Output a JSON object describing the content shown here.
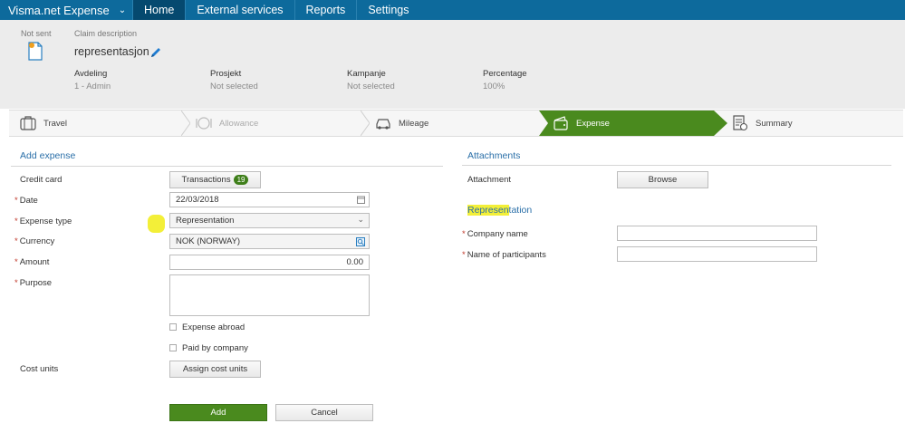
{
  "nav": {
    "brand": "Visma.net Expense",
    "tabs": [
      "Home",
      "External services",
      "Reports",
      "Settings"
    ],
    "active_tab": "Home"
  },
  "header": {
    "status": "Not sent",
    "claim_label": "Claim description",
    "claim_title": "representasjon",
    "meta": [
      {
        "key": "Avdeling",
        "value": "1 - Admin"
      },
      {
        "key": "Prosjekt",
        "value": "Not selected"
      },
      {
        "key": "Kampanje",
        "value": "Not selected"
      },
      {
        "key": "Percentage",
        "value": "100%"
      }
    ]
  },
  "steps": [
    {
      "label": "Travel",
      "icon": "suitcase-icon",
      "state": "normal"
    },
    {
      "label": "Allowance",
      "icon": "plate-icon",
      "state": "disabled"
    },
    {
      "label": "Mileage",
      "icon": "car-icon",
      "state": "normal"
    },
    {
      "label": "Expense",
      "icon": "wallet-icon",
      "state": "active"
    },
    {
      "label": "Summary",
      "icon": "document-icon",
      "state": "normal"
    }
  ],
  "add_expense": {
    "title": "Add expense",
    "credit_card_label": "Credit card",
    "transactions_label": "Transactions",
    "transactions_count": "19",
    "date_label": "Date",
    "date_value": "22/03/2018",
    "expense_type_label": "Expense type",
    "expense_type_value": "Representation",
    "currency_label": "Currency",
    "currency_value": "NOK (NORWAY)",
    "amount_label": "Amount",
    "amount_value": "0.00",
    "purpose_label": "Purpose",
    "purpose_value": "",
    "expense_abroad_label": "Expense abroad",
    "paid_by_company_label": "Paid by company",
    "cost_units_label": "Cost units",
    "assign_cost_units_label": "Assign cost units",
    "add_label": "Add",
    "cancel_label": "Cancel"
  },
  "attachments": {
    "title": "Attachments",
    "attachment_label": "Attachment",
    "browse_label": "Browse"
  },
  "representation": {
    "title_highlighted": "Represen",
    "title_rest": "tation",
    "company_name_label": "Company name",
    "company_name_value": "",
    "participants_label": "Name of participants",
    "participants_value": ""
  },
  "colors": {
    "nav_bg": "#0d6a9c",
    "nav_active": "#05496f",
    "accent_green": "#4a8a1e",
    "link_blue": "#2a6fa8",
    "required_red": "#c0392b",
    "highlight_yellow": "#f3ef38"
  }
}
